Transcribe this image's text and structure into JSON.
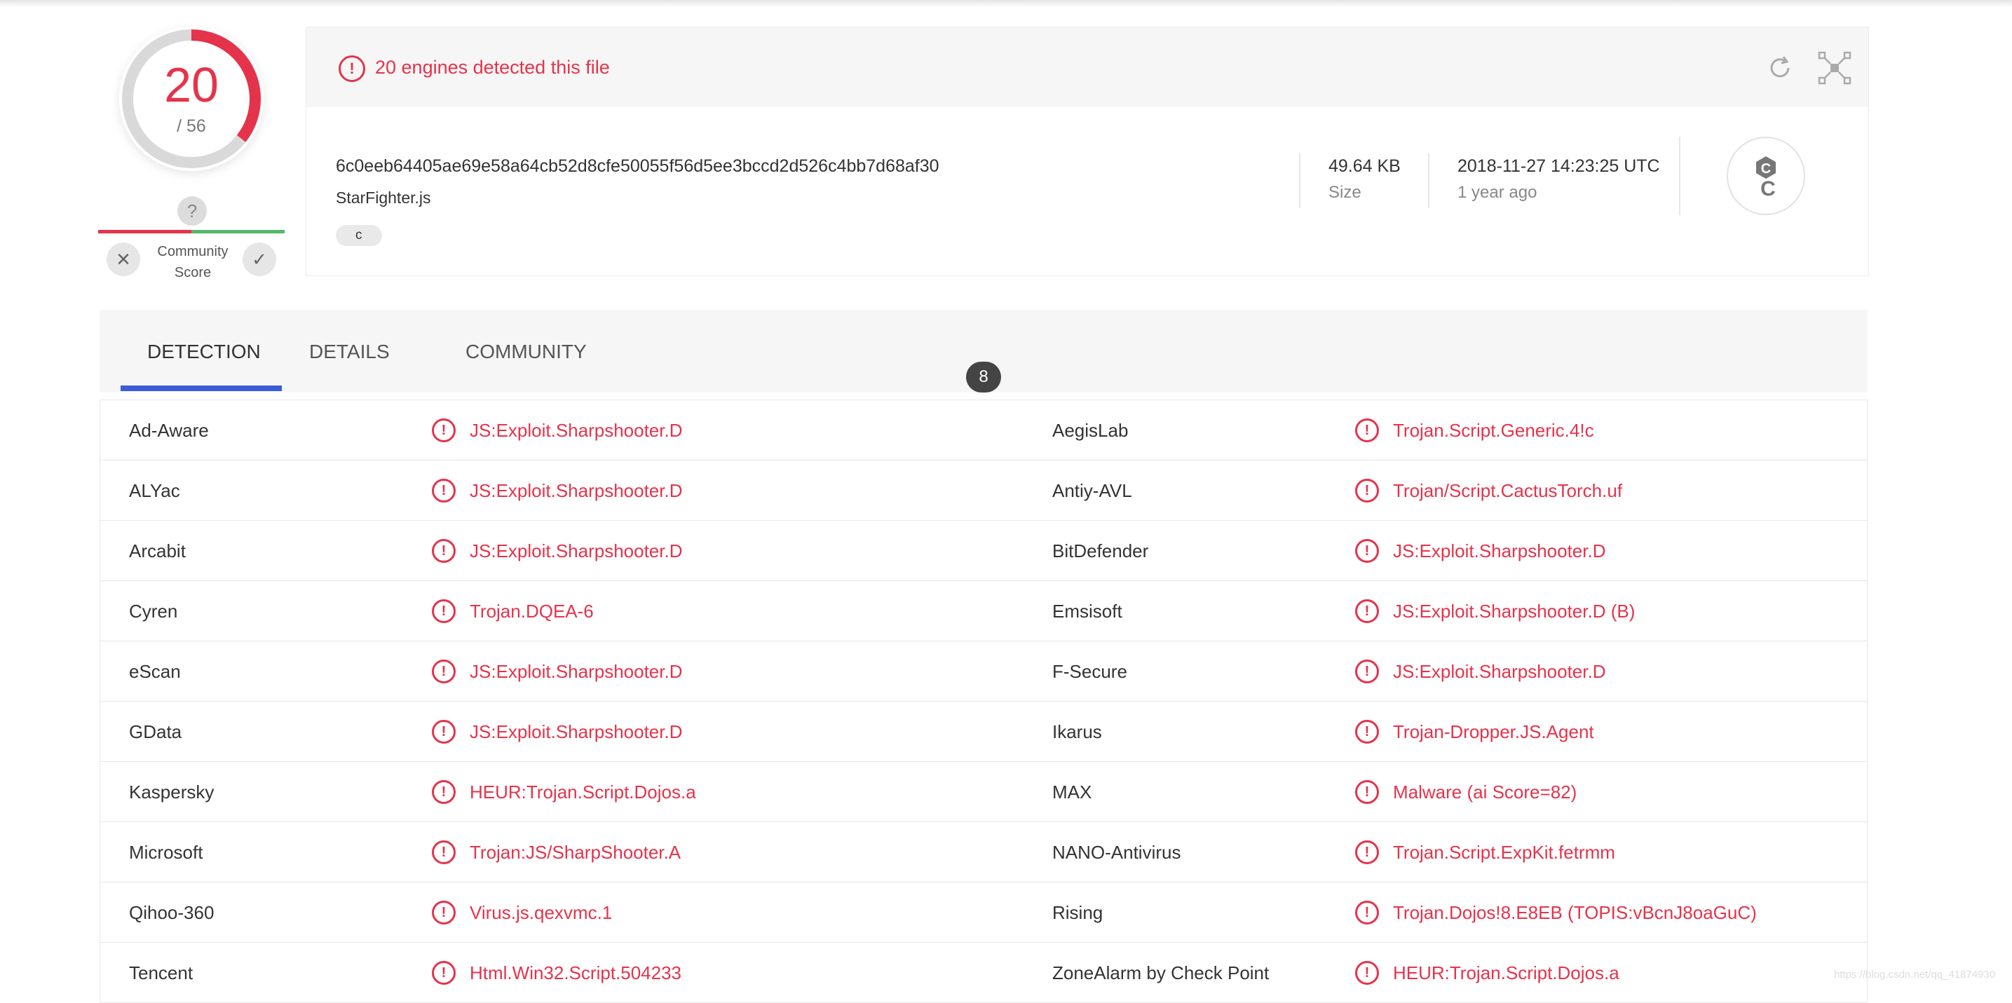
{
  "score": {
    "detections": "20",
    "total": "/ 56",
    "detection_ratio": 0.357,
    "community_label_line1": "Community",
    "community_label_line2": "Score",
    "unknown_glyph": "?",
    "vote_down_glyph": "✕",
    "vote_up_glyph": "✓"
  },
  "summary": {
    "alert_glyph": "!",
    "title": "20 engines detected this file",
    "hash": "6c0eeb64405ae69e58a64cb52d8cfe50055f56d5ee3bccd2d526c4bb7d68af30",
    "file_name": "StarFighter.js",
    "tag": "c",
    "size_value": "49.64 KB",
    "size_label": "Size",
    "date_value": "2018-11-27 14:23:25 UTC",
    "date_relative": "1 year ago",
    "file_type_icon": "file-type-c-icon"
  },
  "tabs": {
    "detection": "DETECTION",
    "details": "DETAILS",
    "community": "COMMUNITY",
    "community_count": "8"
  },
  "results": [
    {
      "left_engine": "Ad-Aware",
      "left_result": "JS:Exploit.Sharpshooter.D",
      "right_engine": "AegisLab",
      "right_result": "Trojan.Script.Generic.4!c"
    },
    {
      "left_engine": "ALYac",
      "left_result": "JS:Exploit.Sharpshooter.D",
      "right_engine": "Antiy-AVL",
      "right_result": "Trojan/Script.CactusTorch.uf"
    },
    {
      "left_engine": "Arcabit",
      "left_result": "JS:Exploit.Sharpshooter.D",
      "right_engine": "BitDefender",
      "right_result": "JS:Exploit.Sharpshooter.D"
    },
    {
      "left_engine": "Cyren",
      "left_result": "Trojan.DQEA-6",
      "right_engine": "Emsisoft",
      "right_result": "JS:Exploit.Sharpshooter.D (B)"
    },
    {
      "left_engine": "eScan",
      "left_result": "JS:Exploit.Sharpshooter.D",
      "right_engine": "F-Secure",
      "right_result": "JS:Exploit.Sharpshooter.D"
    },
    {
      "left_engine": "GData",
      "left_result": "JS:Exploit.Sharpshooter.D",
      "right_engine": "Ikarus",
      "right_result": "Trojan-Dropper.JS.Agent"
    },
    {
      "left_engine": "Kaspersky",
      "left_result": "HEUR:Trojan.Script.Dojos.a",
      "right_engine": "MAX",
      "right_result": "Malware (ai Score=82)"
    },
    {
      "left_engine": "Microsoft",
      "left_result": "Trojan:JS/SharpShooter.A",
      "right_engine": "NANO-Antivirus",
      "right_result": "Trojan.Script.ExpKit.fetrmm"
    },
    {
      "left_engine": "Qihoo-360",
      "left_result": "Virus.js.qexvmc.1",
      "right_engine": "Rising",
      "right_result": "Trojan.Dojos!8.E8EB (TOPIS:vBcnJ8oaGuC)"
    },
    {
      "left_engine": "Tencent",
      "left_result": "Html.Win32.Script.504233",
      "right_engine": "ZoneAlarm by Check Point",
      "right_result": "HEUR:Trojan.Script.Dojos.a"
    }
  ],
  "colors": {
    "detected_red": "#e5334b",
    "accent_blue": "#3b5bdb",
    "positive_green": "#53b96a"
  },
  "watermark": "https://blog.csdn.net/qq_41874930"
}
